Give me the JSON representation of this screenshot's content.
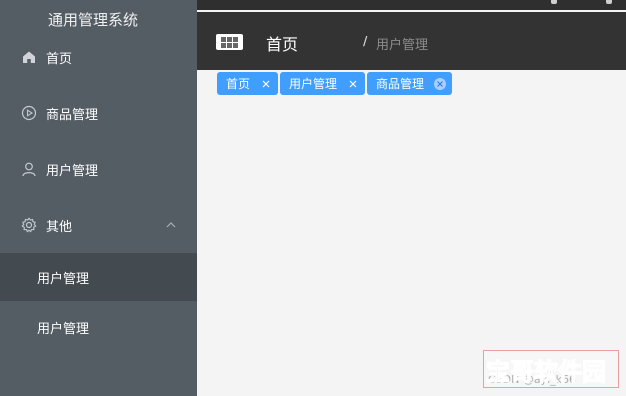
{
  "sidebar": {
    "title": "通用管理系统",
    "items": [
      {
        "label": "首页",
        "icon": "home-icon"
      },
      {
        "label": "商品管理",
        "icon": "video-play-icon"
      },
      {
        "label": "用户管理",
        "icon": "user-icon"
      },
      {
        "label": "其他",
        "icon": "setting-icon"
      }
    ],
    "submenu": [
      {
        "label": "用户管理",
        "active": true
      },
      {
        "label": "用户管理",
        "active": false
      }
    ]
  },
  "header": {
    "breadcrumb_home": "首页",
    "breadcrumb_separator": "/",
    "breadcrumb_current": "用户管理"
  },
  "tags": [
    {
      "label": "首页"
    },
    {
      "label": "用户管理"
    },
    {
      "label": "商品管理",
      "current": true
    }
  ],
  "watermark": {
    "text": "宝哥软件园",
    "subtext": "CSDN @ayi_k66"
  },
  "colors": {
    "sidebar_bg": "#545c64",
    "sidebar_active_bg": "#434a50",
    "header_bg": "#333333",
    "tag_bg": "#409eff",
    "content_bg": "#f4f4f4"
  }
}
